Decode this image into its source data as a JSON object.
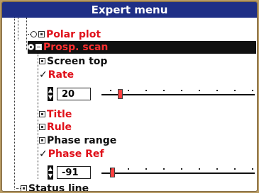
{
  "window": {
    "title": "Expert menu"
  },
  "items": [
    {
      "label": "Polar plot"
    },
    {
      "label": "Prosp. scan"
    },
    {
      "label": "Screen top"
    },
    {
      "label": "Rate"
    },
    {
      "label": "Title"
    },
    {
      "label": "Rule"
    },
    {
      "label": "Phase range"
    },
    {
      "label": "Phase Ref"
    },
    {
      "label": "Status line"
    }
  ],
  "rate_control": {
    "value": "20",
    "level": 0.07
  },
  "phase_ref_control": {
    "value": "-91",
    "level": 0.02
  }
}
